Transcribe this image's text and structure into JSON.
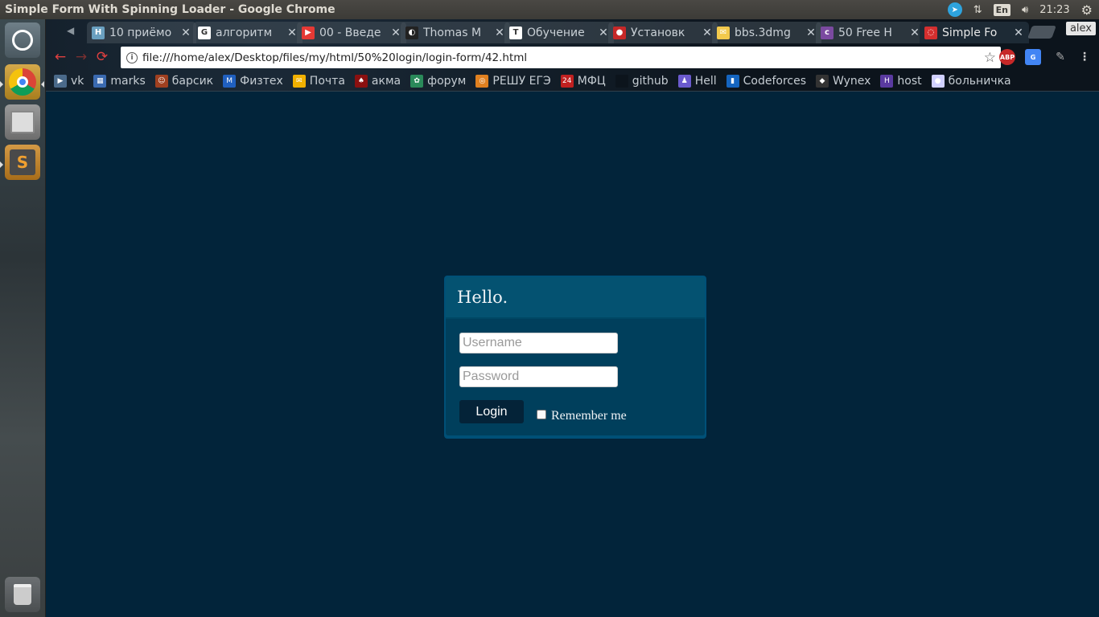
{
  "system": {
    "window_title": "Simple Form With Spinning Loader - Google Chrome",
    "time": "21:23",
    "keyboard_layout": "En",
    "profile_name": "alex"
  },
  "launcher": {
    "items": [
      "ubuntu-dash",
      "google-chrome",
      "files",
      "sublime-text",
      "trash"
    ]
  },
  "tabs": [
    {
      "title": "10 приёмо",
      "favicon": "H",
      "color": "#6aa0c0"
    },
    {
      "title": "алгоритм",
      "favicon": "G",
      "color": "#ffffff"
    },
    {
      "title": "00 - Введе",
      "favicon": "▶",
      "color": "#e53935"
    },
    {
      "title": "Thomas M",
      "favicon": "◐",
      "color": "#222222"
    },
    {
      "title": "Обучение",
      "favicon": "T",
      "color": "#ffffff"
    },
    {
      "title": "Установк",
      "favicon": "●",
      "color": "#c62828"
    },
    {
      "title": "bbs.3dmg",
      "favicon": "✉",
      "color": "#f2c94c"
    },
    {
      "title": "50 Free H",
      "favicon": "c",
      "color": "#7b4aa0"
    },
    {
      "title": "Simple Fo",
      "favicon": "◌",
      "color": "#d32f2f",
      "active": true
    }
  ],
  "toolbar": {
    "url": "file:///home/alex/Desktop/files/my/html/50%20login/login-form/42.html",
    "extensions": [
      "ABP",
      "G"
    ]
  },
  "bookmarks": [
    {
      "label": "vk",
      "icon": "▶",
      "color": "#4a6a8a"
    },
    {
      "label": "marks",
      "icon": "▦",
      "color": "#3a6ab0"
    },
    {
      "label": "барсик",
      "icon": "☺",
      "color": "#a04020"
    },
    {
      "label": "Физтех",
      "icon": "M",
      "color": "#2060c0"
    },
    {
      "label": "Почта",
      "icon": "✉",
      "color": "#f0b000"
    },
    {
      "label": "акма",
      "icon": "♠",
      "color": "#8a1010"
    },
    {
      "label": "форум",
      "icon": "✿",
      "color": "#2a8a5a"
    },
    {
      "label": "РЕШУ ЕГЭ",
      "icon": "◎",
      "color": "#e08020"
    },
    {
      "label": "МФЦ",
      "icon": "24",
      "color": "#c02020"
    },
    {
      "label": "github",
      "icon": "",
      "color": "#0c141c"
    },
    {
      "label": "Hell",
      "icon": "♟",
      "color": "#6a5acd"
    },
    {
      "label": "Codeforces",
      "icon": "▮",
      "color": "#1565c0"
    },
    {
      "label": "Wynex",
      "icon": "◆",
      "color": "#333333"
    },
    {
      "label": "host",
      "icon": "H",
      "color": "#5a3aa0"
    },
    {
      "label": "больничка",
      "icon": "●",
      "color": "#d0d0ff"
    }
  ],
  "form": {
    "heading": "Hello.",
    "username_placeholder": "Username",
    "password_placeholder": "Password",
    "login_label": "Login",
    "remember_label": "Remember me",
    "remember_checked": false,
    "colors": {
      "page_bg": "#02243a",
      "card_bg": "#005077",
      "button_bg": "#042338"
    }
  }
}
